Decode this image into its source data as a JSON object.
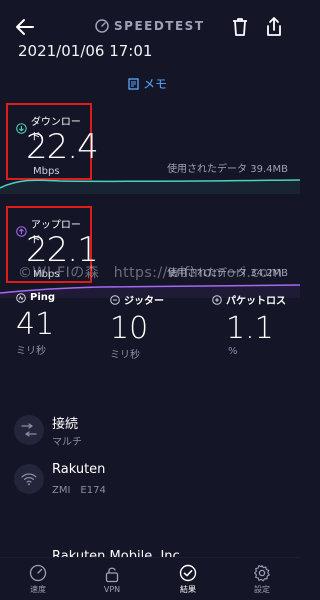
{
  "header": {
    "brand": "SPEEDTEST",
    "back_icon": "arrow-left-icon",
    "delete_icon": "trash-icon",
    "share_icon": "share-icon"
  },
  "result": {
    "datetime": "2021/01/06 17:01",
    "memo_label": "メモ"
  },
  "download": {
    "label": "ダウンロード",
    "value": "22.4",
    "unit": "Mbps",
    "data_used": "使用されたデータ 39.4MB",
    "color": "#4cd3c2"
  },
  "upload": {
    "label": "アップロード",
    "value": "22.1",
    "unit": "Mbps",
    "data_used": "使用されたデータ 34.2MB",
    "color": "#a56af0"
  },
  "watermark": "©WI-FIの森　https://wifinomori.com",
  "stats": {
    "ping": {
      "label": "Ping",
      "value": "41",
      "unit": "ミリ秒"
    },
    "jitter": {
      "label": "ジッター",
      "value": "10",
      "unit": "ミリ秒"
    },
    "packet_loss": {
      "label": "パケットロス",
      "value": "1.1",
      "unit": "%"
    }
  },
  "connection": {
    "title": "接続",
    "sub": "マルチ"
  },
  "provider": {
    "title": "Rakuten",
    "sub": "ZMI　E174"
  },
  "server": {
    "title": "Rakuten Mobile, Inc"
  },
  "nav": {
    "speed": "速度",
    "vpn": "VPN",
    "results": "結果",
    "settings": "設定"
  },
  "colors": {
    "background": "#141526",
    "highlight_box": "#e11a1a",
    "link": "#5aa8ff"
  }
}
